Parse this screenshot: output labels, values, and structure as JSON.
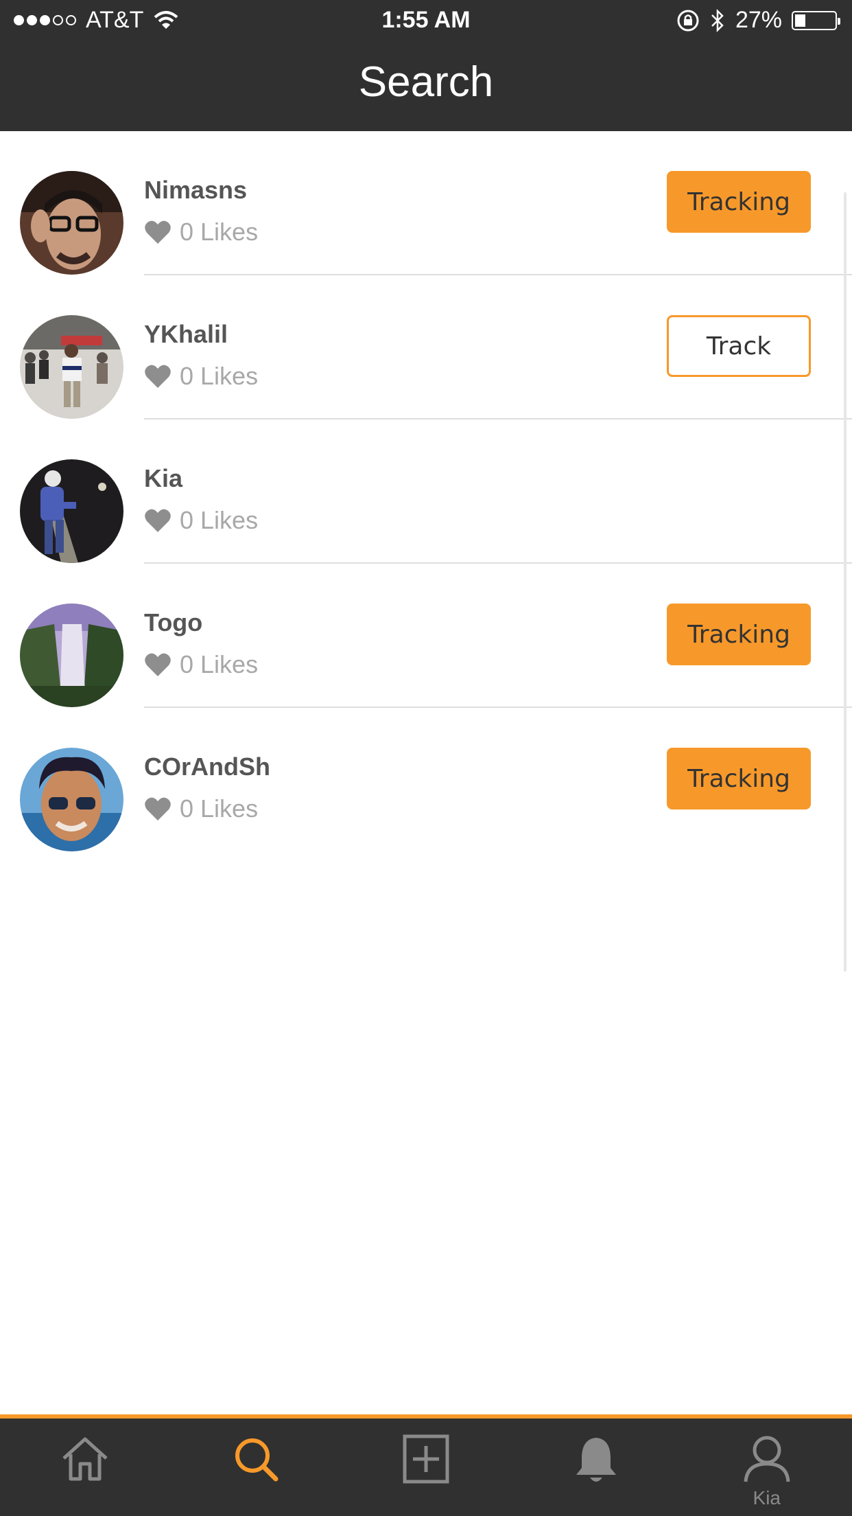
{
  "status": {
    "carrier": "AT&T",
    "signal_bars_filled": 3,
    "signal_bars_total": 5,
    "time": "1:55 AM",
    "battery_percent_label": "27%",
    "battery_level": 0.27
  },
  "header": {
    "title": "Search"
  },
  "users": [
    {
      "name": "Nimasns",
      "likes": "0 Likes",
      "button": "Tracking",
      "state": "tracking"
    },
    {
      "name": "YKhalil",
      "likes": "0 Likes",
      "button": "Track",
      "state": "track"
    },
    {
      "name": "Kia",
      "likes": "0 Likes",
      "button": "",
      "state": "none"
    },
    {
      "name": "Togo",
      "likes": "0 Likes",
      "button": "Tracking",
      "state": "tracking"
    },
    {
      "name": "COrAndSh",
      "likes": "0 Likes",
      "button": "Tracking",
      "state": "tracking"
    }
  ],
  "tabbar": {
    "items": [
      {
        "icon": "home-icon",
        "label": ""
      },
      {
        "icon": "search-icon",
        "label": "",
        "active": true
      },
      {
        "icon": "add-post-icon",
        "label": ""
      },
      {
        "icon": "bell-icon",
        "label": ""
      },
      {
        "icon": "profile-icon",
        "label": "Kia"
      }
    ]
  },
  "colors": {
    "accent": "#f7992a",
    "bar_bg": "#303030",
    "icon_inactive": "#8a8a8a",
    "name_text": "#555555",
    "likes_text": "#a8a8a8"
  }
}
